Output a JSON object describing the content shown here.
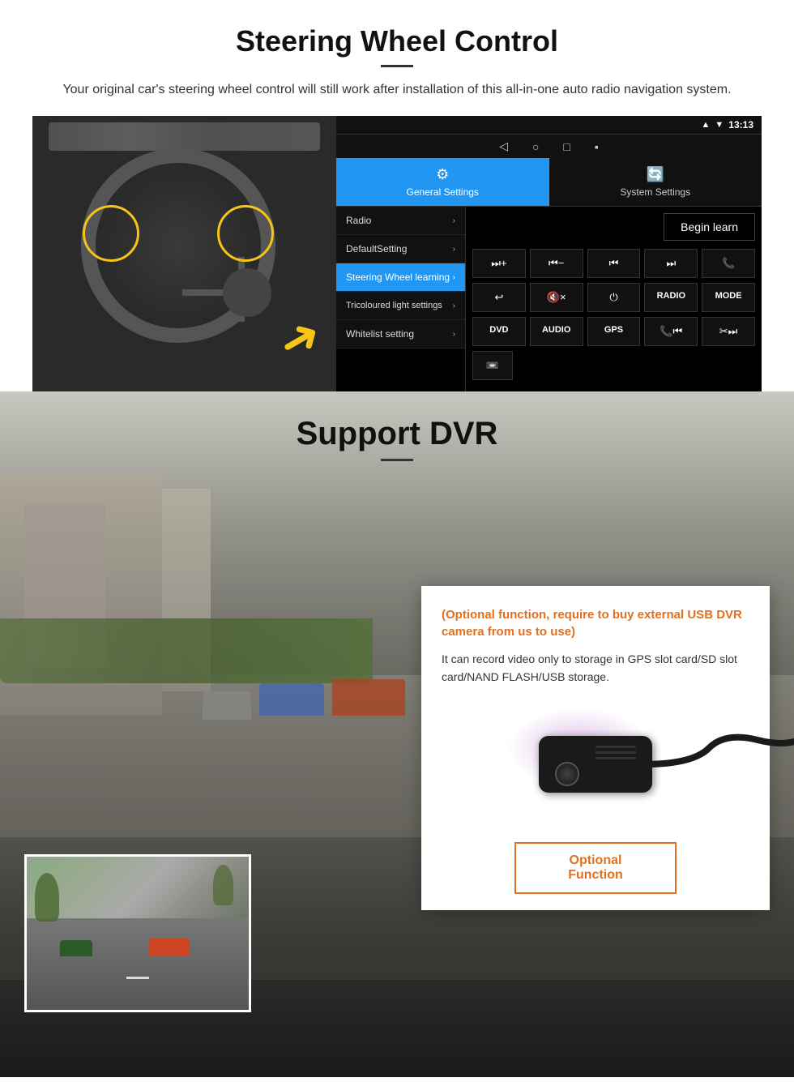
{
  "section1": {
    "title": "Steering Wheel Control",
    "subtitle": "Your original car's steering wheel control will still work after installation of this all-in-one auto radio navigation system.",
    "divider": "—",
    "android": {
      "statusbar": {
        "signal": "▲",
        "wifi": "▼",
        "time": "13:13"
      },
      "nav_buttons": [
        "◁",
        "○",
        "□",
        "▪"
      ],
      "tabs": [
        {
          "icon": "⚙",
          "label": "General Settings",
          "active": true
        },
        {
          "icon": "🔄",
          "label": "System Settings",
          "active": false
        }
      ],
      "menu_items": [
        {
          "label": "Radio",
          "active": false
        },
        {
          "label": "DefaultSetting",
          "active": false
        },
        {
          "label": "Steering Wheel learning",
          "active": true
        },
        {
          "label": "Tricoloured light settings",
          "active": false
        },
        {
          "label": "Whitelist setting",
          "active": false
        }
      ],
      "begin_learn": "Begin learn",
      "control_rows": [
        [
          "⏭+",
          "⏮−",
          "⏮⏮",
          "⏭⏭",
          "📞"
        ],
        [
          "↩",
          "🔇×",
          "⏻",
          "RADIO",
          "MODE"
        ],
        [
          "DVD",
          "AUDIO",
          "GPS",
          "📞⏮",
          "✂⏭⏭"
        ],
        [
          "📼"
        ]
      ]
    }
  },
  "section2": {
    "title": "Support DVR",
    "divider": "—",
    "card": {
      "orange_text": "(Optional function, require to buy external USB DVR camera from us to use)",
      "body_text": "It can record video only to storage in GPS slot card/SD slot card/NAND FLASH/USB storage.",
      "optional_button": "Optional Function"
    }
  }
}
